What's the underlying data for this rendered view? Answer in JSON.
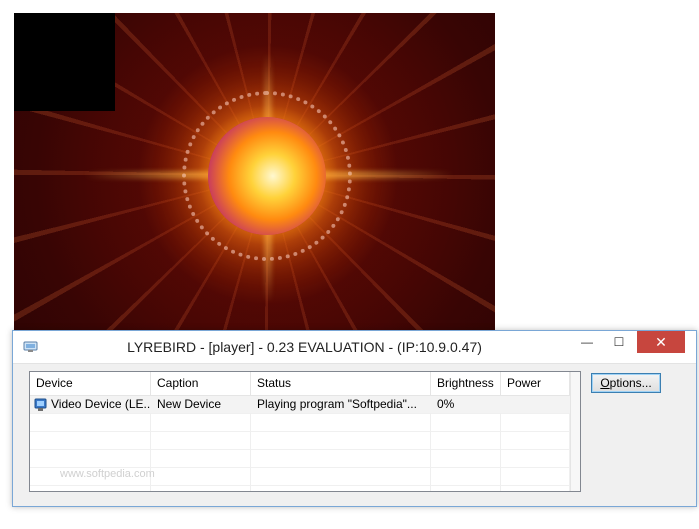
{
  "window": {
    "title": "LYREBIRD - [player] - 0.23 EVALUATION - (IP:10.9.0.47)",
    "minimize_glyph": "—",
    "maximize_glyph": "☐",
    "close_glyph": "✕"
  },
  "device_list": {
    "columns": [
      "Device",
      "Caption",
      "Status",
      "Brightness",
      "Power"
    ],
    "rows": [
      {
        "device": "Video Device (LE...",
        "caption": "New Device",
        "status": "Playing program \"Softpedia\"...",
        "brightness": "0%",
        "power": ""
      }
    ]
  },
  "buttons": {
    "options_accel": "O",
    "options_rest": "ptions..."
  },
  "watermark": "www.softpedia.com",
  "colors": {
    "close_button": "#c7463e",
    "button_border": "#3c7fb1",
    "window_border": "#7aa7d6"
  },
  "icons": {
    "app": "app-monitor-icon",
    "device": "device-monitor-icon"
  }
}
